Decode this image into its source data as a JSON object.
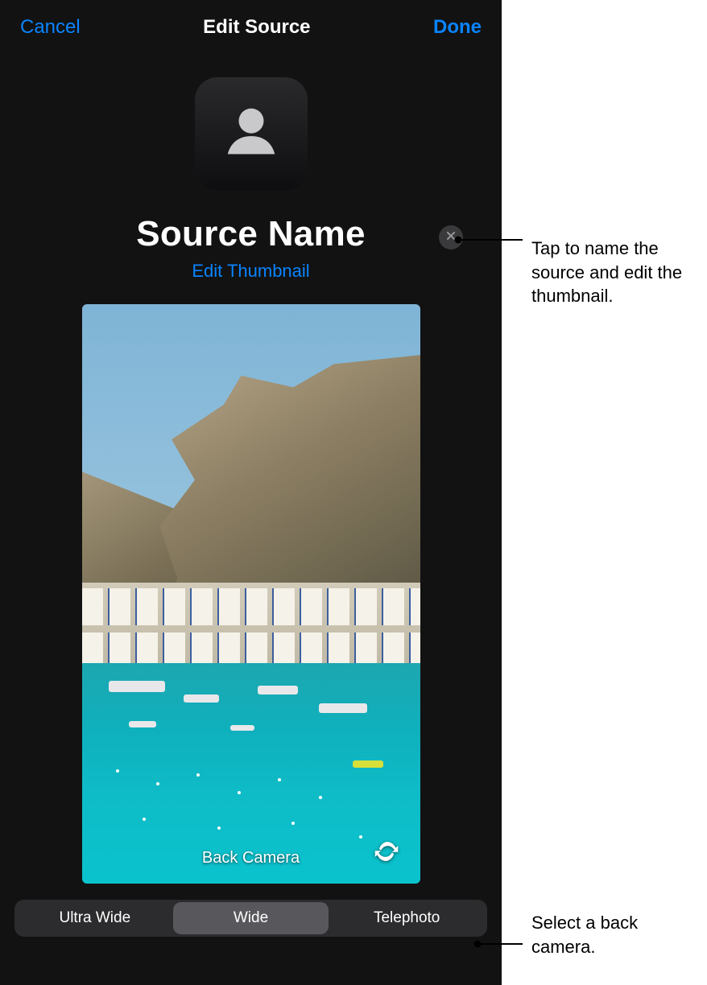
{
  "nav": {
    "cancel": "Cancel",
    "title": "Edit Source",
    "done": "Done"
  },
  "source": {
    "name": "Source Name",
    "edit_thumbnail": "Edit Thumbnail"
  },
  "preview": {
    "label": "Back Camera"
  },
  "lenses": {
    "items": [
      "Ultra Wide",
      "Wide",
      "Telephoto"
    ],
    "selected_index": 1
  },
  "callouts": {
    "name_edit": "Tap to name the source and edit the thumbnail.",
    "lens_select": "Select a back camera."
  },
  "icons": {
    "thumbnail": "person-silhouette-icon",
    "clear": "xmark-circle-icon",
    "flip": "camera-flip-icon"
  },
  "colors": {
    "accent": "#0a84ff",
    "panel_bg": "#121212",
    "segment_bg": "#2c2c2e",
    "segment_selected": "#58585c"
  }
}
